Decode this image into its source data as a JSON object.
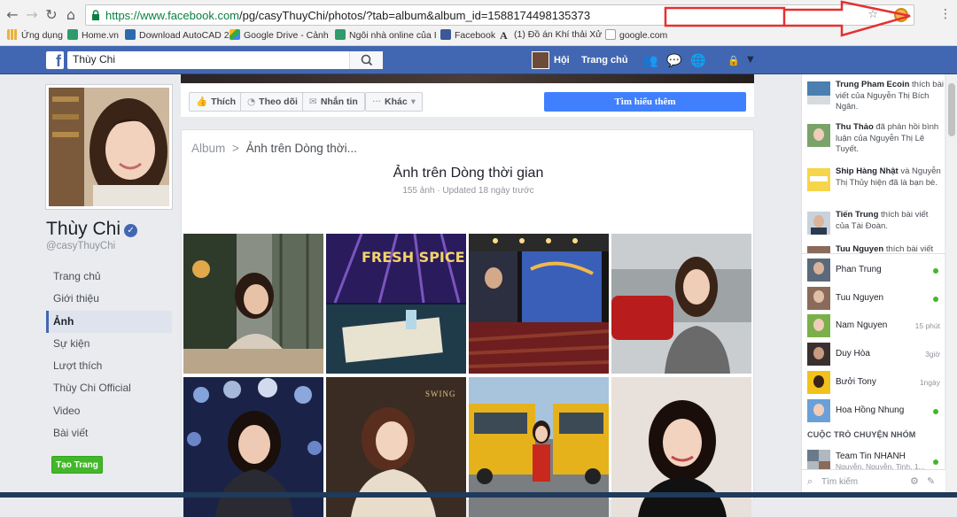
{
  "browser": {
    "url_host": "https://www.facebook.com",
    "url_path": "/pg/casyThuyChi/photos/?tab=album&album_id=1588174498135373",
    "bookmarks": [
      {
        "label": "Ứng dụng",
        "color": "#e8b23c"
      },
      {
        "label": "Home.vn",
        "color": "#2f9a6b"
      },
      {
        "label": "Download AutoCAD 2",
        "color": "#2b6cb0"
      },
      {
        "label": "Google Drive - Cảnh",
        "color": "#4caf50"
      },
      {
        "label": "Ngôi nhà online của I",
        "color": "#2f9a6b"
      },
      {
        "label": "Facebook",
        "color": "#3b5998"
      },
      {
        "label": "(1) Đồ án Khí thải Xử",
        "color": "#222222"
      },
      {
        "label": "google.com",
        "color": "#9e9e9e"
      }
    ]
  },
  "fb": {
    "search_value": "Thùy Chi",
    "nav_hoi": "Hội",
    "nav_home": "Trang chủ"
  },
  "page": {
    "name": "Thùy Chi",
    "handle": "@casyThuyChi",
    "nav": [
      "Trang chủ",
      "Giới thiệu",
      "Ảnh",
      "Sự kiện",
      "Lượt thích",
      "Thùy Chi Official",
      "Video",
      "Bài viết"
    ],
    "active_nav": "Ảnh",
    "create_page": "Tạo Trang",
    "actions": {
      "like": "Thích",
      "follow": "Theo dõi",
      "message": "Nhắn tin",
      "more": "Khác",
      "learn_more": "Tìm hiểu thêm"
    }
  },
  "album": {
    "crumb_root": "Album",
    "crumb_sep": ">",
    "crumb_current": "Ảnh trên Dòng thời...",
    "title": "Ảnh trên Dòng thời gian",
    "meta": "155 ảnh · Updated 18 ngày trước",
    "photo_spice_text": "FRESH SPICE",
    "photo_swing_text": "SWING"
  },
  "ticker": [
    {
      "name": "Trung Pham Ecoin",
      "text": "thích bài viết của Nguyễn Thị Bích Ngân."
    },
    {
      "name": "Thu Thảo",
      "text": "đã phản hồi bình luận của Nguyễn Thị Lê Tuyết."
    },
    {
      "name": "Ship Hàng Nhật",
      "text": "và Nguyễn Thị Thủy hiện đã là bạn bè."
    },
    {
      "name": "Tiến Trung",
      "text": "thích bài viết của Tài Đoàn."
    },
    {
      "name": "Tuu Nguyen",
      "text": "thích bài viết"
    }
  ],
  "chat": {
    "contacts": [
      {
        "name": "Phan Trung",
        "status": "online",
        "time": ""
      },
      {
        "name": "Tuu Nguyen",
        "status": "online",
        "time": ""
      },
      {
        "name": "Nam Nguyen",
        "status": "idle",
        "time": "15 phút"
      },
      {
        "name": "Duy Hòa",
        "status": "idle",
        "time": "3giờ"
      },
      {
        "name": "Bưởi Tony",
        "status": "idle",
        "time": "1ngày"
      },
      {
        "name": "Hoa Hồng Nhung",
        "status": "online",
        "time": ""
      }
    ],
    "group_header": "CUỘC TRÒ CHUYỆN NHÓM",
    "group": {
      "name": "Team Tin NHANH",
      "members": "Nguyễn, Nguyễn, Tinh, 1..."
    },
    "search_placeholder": "Tìm kiếm"
  }
}
